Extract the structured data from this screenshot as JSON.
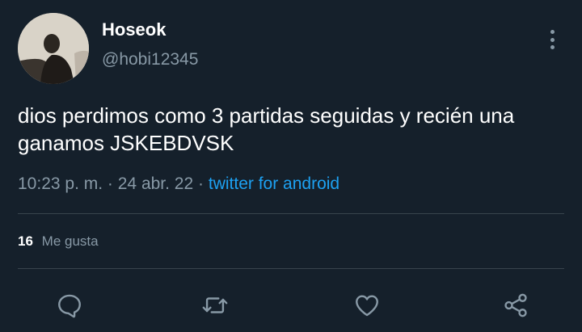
{
  "user": {
    "display_name": "Hoseok",
    "handle": "@hobi12345"
  },
  "tweet": {
    "text": "dios perdimos como 3 partidas seguidas y recién una ganamos JSKEBDVSK",
    "time": "10:23 p. m.",
    "date": "24 abr. 22",
    "source": "twitter for android",
    "separator": "·"
  },
  "stats": {
    "likes_count": "16",
    "likes_label": "Me gusta"
  },
  "actions": {
    "icons": [
      "reply-icon",
      "retweet-icon",
      "like-icon",
      "share-icon"
    ]
  },
  "colors": {
    "background": "#15202b",
    "secondary_text": "#8899a6",
    "accent": "#1da1f2",
    "divider": "#38444d"
  }
}
